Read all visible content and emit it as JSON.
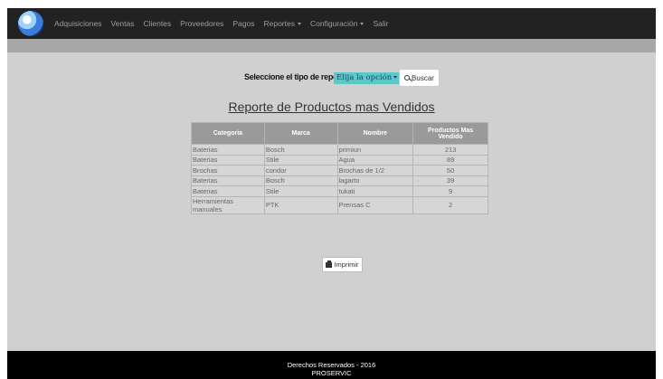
{
  "nav": {
    "items": [
      {
        "label": "Adquisiciones"
      },
      {
        "label": "Ventas"
      },
      {
        "label": "Clientes"
      },
      {
        "label": "Proveedores"
      },
      {
        "label": "Pagos"
      },
      {
        "label": "Reportes"
      },
      {
        "label": "Configuración"
      },
      {
        "label": "Salir"
      }
    ]
  },
  "filter": {
    "label": "Seleccione el tipo de reporte",
    "select_value": "Elija la opción",
    "search_button": "Buscar"
  },
  "report": {
    "title": "Reporte de Productos mas Vendidos",
    "columns": [
      "Categoria",
      "Marca",
      "Nombre",
      "Productos Mas Vendido"
    ],
    "rows": [
      [
        "Baterias",
        "Bosch",
        "primiun",
        "213"
      ],
      [
        "Baterias",
        "Stile",
        "Agua",
        "89"
      ],
      [
        "Brochas",
        "condor",
        "Brochas de 1/2",
        "50"
      ],
      [
        "Baterias",
        "Bosch",
        "lagarto",
        "39"
      ],
      [
        "Baterias",
        "Stile",
        "tukati",
        "9"
      ],
      [
        "Herramientas manuales",
        "PTK",
        "Prensas C",
        "2"
      ]
    ],
    "print_button": "Imprimir"
  },
  "footer": {
    "line1": "Derechos Reservados - 2016",
    "line2": "PROSERVIC"
  }
}
